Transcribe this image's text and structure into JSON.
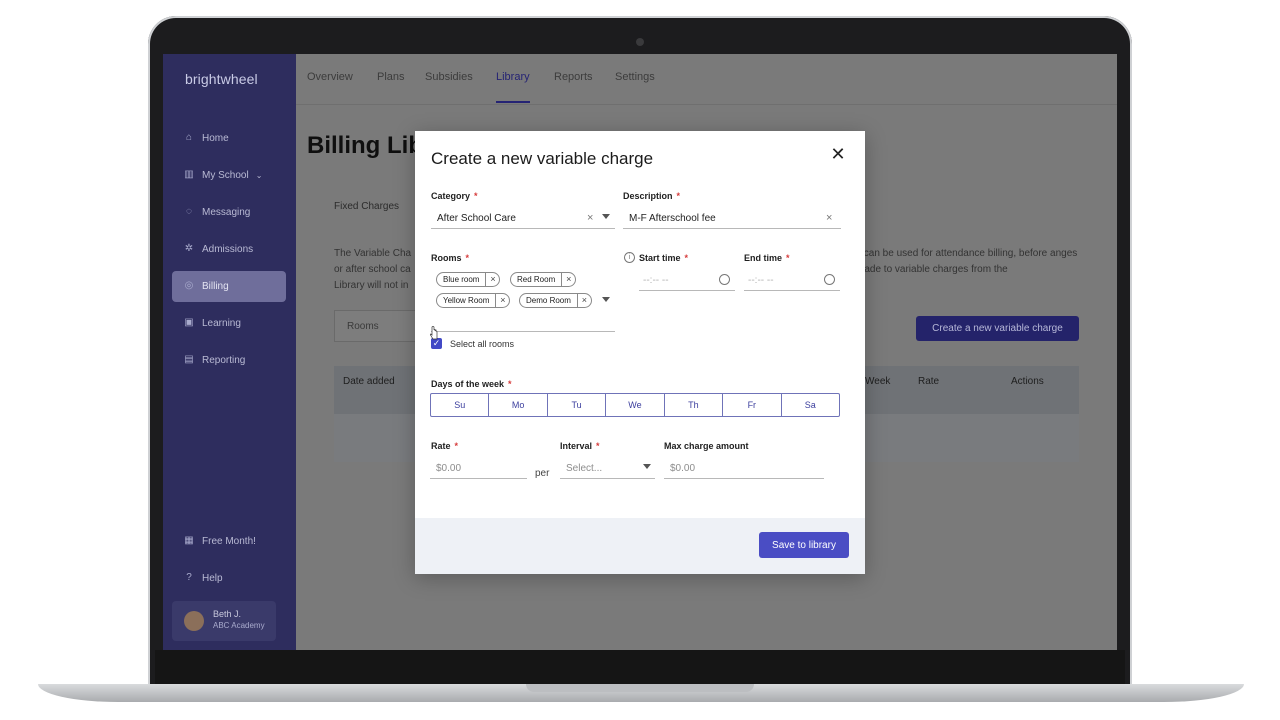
{
  "app": {
    "logo": "brightwheel",
    "nav": [
      {
        "label": "Home",
        "icon": "home-icon"
      },
      {
        "label": "My School",
        "icon": "school-icon"
      },
      {
        "label": "Messaging",
        "icon": "message-icon"
      },
      {
        "label": "Admissions",
        "icon": "admissions-icon"
      },
      {
        "label": "Billing",
        "icon": "billing-icon"
      },
      {
        "label": "Learning",
        "icon": "learning-icon"
      },
      {
        "label": "Reporting",
        "icon": "reporting-icon"
      },
      {
        "label": "Free Month!",
        "icon": "gift-icon"
      },
      {
        "label": "Help",
        "icon": "help-icon"
      }
    ],
    "user": {
      "name": "Beth J.",
      "school": "ABC Academy"
    }
  },
  "topnav": {
    "tabs": [
      "Overview",
      "Plans",
      "Subsidies",
      "Library",
      "Reports",
      "Settings"
    ],
    "active": "Library"
  },
  "page": {
    "title": "Billing Lib",
    "sub_tab": "Fixed Charges",
    "desc_left": "The Variable Cha or after school ca Library will not in",
    "desc_right": "s can be used for attendance billing, before anges made to variable charges from the",
    "rooms_filter": "Rooms",
    "create_button": "Create a new variable charge",
    "table_headers": [
      "Date added",
      "Week",
      "Rate",
      "Actions"
    ]
  },
  "modal": {
    "title": "Create a new variable charge",
    "category": {
      "label": "Category",
      "value": "After School Care"
    },
    "description": {
      "label": "Description",
      "value": "M-F Afterschool fee"
    },
    "rooms": {
      "label": "Rooms",
      "chips": [
        "Blue room",
        "Red Room",
        "Yellow Room",
        "Demo Room"
      ],
      "select_all": "Select all rooms",
      "select_all_checked": true
    },
    "start_time": {
      "label": "Start time",
      "placeholder": "--:-- --"
    },
    "end_time": {
      "label": "End time",
      "placeholder": "--:-- --"
    },
    "days": {
      "label": "Days of the week",
      "items": [
        "Su",
        "Mo",
        "Tu",
        "We",
        "Th",
        "Fr",
        "Sa"
      ]
    },
    "rate": {
      "label": "Rate",
      "placeholder": "$0.00"
    },
    "per": "per",
    "interval": {
      "label": "Interval",
      "placeholder": "Select..."
    },
    "max_charge": {
      "label": "Max charge amount",
      "placeholder": "$0.00"
    },
    "save_button": "Save to library",
    "required_mark": "*"
  },
  "colors": {
    "accent": "#4a4dc4",
    "sidebar": "#2e2d5e",
    "required": "#d63b3b",
    "chat": "#1c6ad2"
  }
}
